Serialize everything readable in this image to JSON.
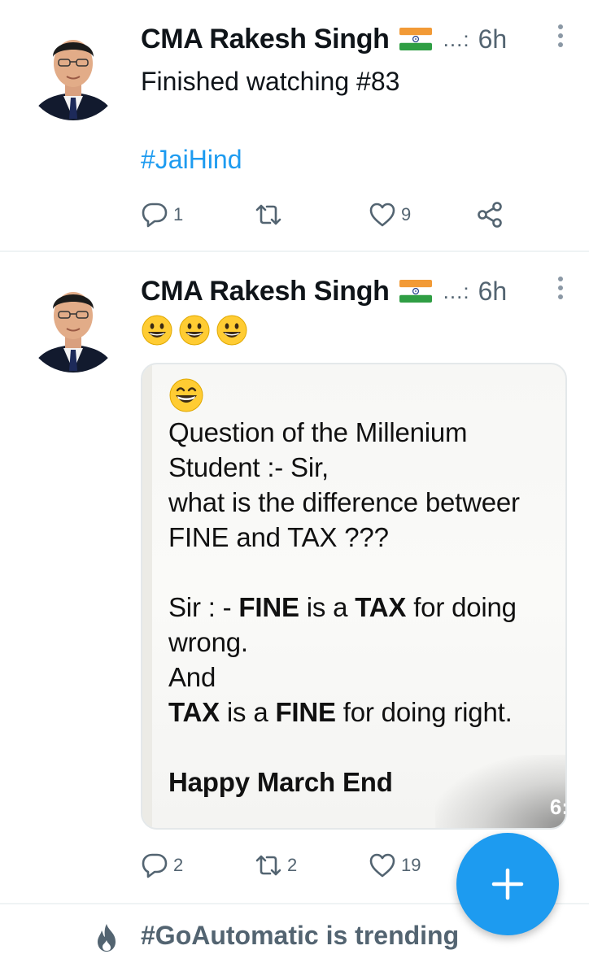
{
  "tweets": [
    {
      "author": "CMA Rakesh Singh",
      "separator": "...:",
      "time": "6h",
      "text_lines": [
        "Finished watching #83"
      ],
      "hashtag": "#JaiHind",
      "reply_count": "1",
      "retweet_count": "",
      "like_count": "9"
    },
    {
      "author": "CMA Rakesh Singh",
      "separator": "...:",
      "time": "6h",
      "emojis": [
        "grinning-face",
        "grinning-face",
        "grinning-face"
      ],
      "image": {
        "line1": "Question of the Millenium",
        "line2": "Student :- Sir,",
        "line3": "what is the difference betweer",
        "line4": "FINE and TAX ???",
        "line5_a": "Sir : - ",
        "line5_b": "FINE",
        "line5_c": " is a ",
        "line5_d": "TAX",
        "line5_e": " for doing",
        "line6": "wrong.",
        "line7": "And",
        "line8_a": "TAX",
        "line8_b": " is a ",
        "line8_c": "FINE",
        "line8_d": " for doing right.",
        "line9": "Happy March End",
        "timestamp": "6:"
      },
      "reply_count": "2",
      "retweet_count": "2",
      "like_count": "19"
    }
  ],
  "trending": {
    "text": "#GoAutomatic is trending"
  },
  "colors": {
    "accent": "#1d9bf0",
    "muted": "#536471",
    "text": "#0f1419"
  },
  "icons": [
    "avatar",
    "india-flag-icon",
    "reply-icon",
    "retweet-icon",
    "like-icon",
    "share-icon",
    "compose-plus-icon",
    "flame-icon"
  ]
}
